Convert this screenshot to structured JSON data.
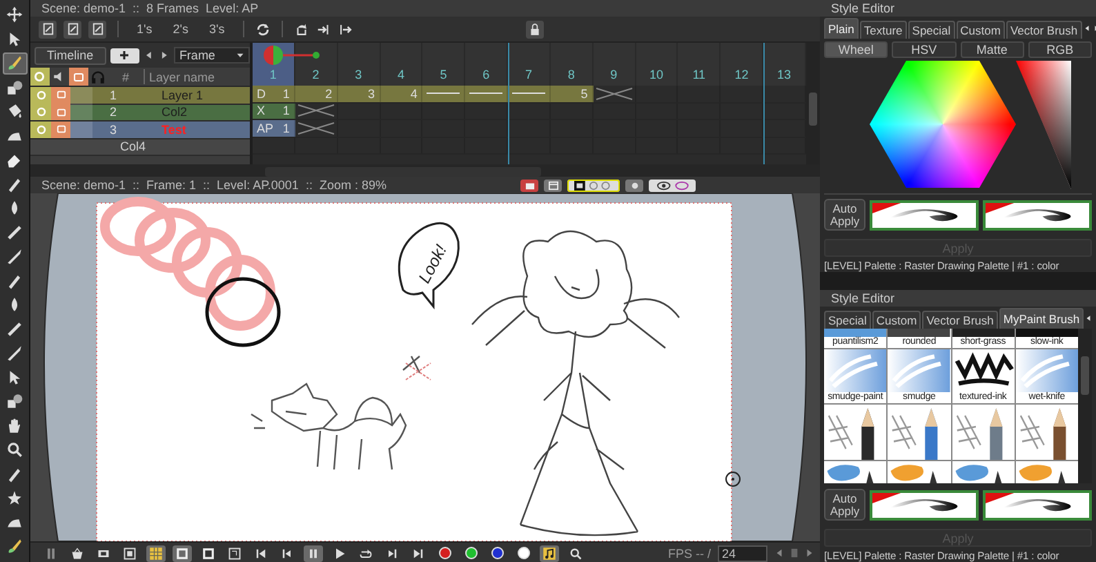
{
  "toolbox": {
    "tools": [
      {
        "kind": "animate",
        "selected": false
      },
      {
        "kind": "arrow",
        "selected": false
      },
      {
        "kind": "brush",
        "selected": true
      },
      {
        "kind": "shapes",
        "selected": false
      },
      {
        "kind": "bucket",
        "selected": false
      },
      {
        "kind": "iron",
        "selected": false
      },
      {
        "kind": "eraser",
        "selected": false
      },
      {
        "kind": "pen",
        "selected": false
      },
      {
        "kind": "drop",
        "selected": false
      },
      {
        "kind": "ruler",
        "selected": false
      },
      {
        "kind": "knife",
        "selected": false
      },
      {
        "kind": "pen",
        "selected": false
      },
      {
        "kind": "drop",
        "selected": false
      },
      {
        "kind": "ruler",
        "selected": false
      },
      {
        "kind": "knife",
        "selected": false
      },
      {
        "kind": "arrow",
        "selected": false
      },
      {
        "kind": "shapes",
        "selected": false
      },
      {
        "kind": "hand",
        "selected": false
      },
      {
        "kind": "zoom",
        "selected": false
      },
      {
        "kind": "pen",
        "selected": false
      },
      {
        "kind": "star",
        "selected": false
      },
      {
        "kind": "iron",
        "selected": false
      },
      {
        "kind": "brush",
        "selected": false
      }
    ]
  },
  "timeline": {
    "title": "Scene: demo-1  ::  8 Frames  Level: AP",
    "step_buttons": [
      {
        "label": "1's"
      },
      {
        "label": "2's"
      },
      {
        "label": "3's"
      }
    ],
    "tab": "Timeline",
    "frame_mode": "Frame",
    "number_header": "#",
    "layer_name_field": {
      "placeholder": "Layer name"
    },
    "frames": [
      {
        "label": "1",
        "selected": true
      },
      {
        "label": "2",
        "selected": false
      },
      {
        "label": "3",
        "selected": false
      },
      {
        "label": "4",
        "selected": false
      },
      {
        "label": "5",
        "selected": false
      },
      {
        "label": "6",
        "selected": false
      },
      {
        "label": "7",
        "selected": false
      },
      {
        "label": "8",
        "selected": false
      },
      {
        "label": "9",
        "selected": false
      },
      {
        "label": "10",
        "selected": false
      },
      {
        "label": "11",
        "selected": false
      },
      {
        "label": "12",
        "selected": false
      },
      {
        "label": "13",
        "selected": false
      }
    ],
    "layers": [
      {
        "number": "1",
        "name": "Layer 1",
        "color": "#77773f",
        "selected": false,
        "preview": true,
        "camstand": true,
        "cells": [
          {
            "kind": "start",
            "level_name": "D",
            "frame": "1"
          },
          {
            "kind": "value",
            "frame": "2"
          },
          {
            "kind": "value",
            "frame": "3"
          },
          {
            "kind": "value",
            "frame": "4"
          },
          {
            "kind": "hold"
          },
          {
            "kind": "hold"
          },
          {
            "kind": "hold"
          },
          {
            "kind": "value",
            "frame": "5"
          },
          {
            "kind": "end"
          }
        ]
      },
      {
        "number": "2",
        "name": "Col2",
        "color": "#4a6e43",
        "selected": false,
        "preview": true,
        "camstand": true,
        "cells": [
          {
            "kind": "start",
            "level_name": "X",
            "frame": "1"
          },
          {
            "kind": "end"
          }
        ]
      },
      {
        "number": "3",
        "name": "Test",
        "color": "#5a6d8c",
        "selected": true,
        "preview": true,
        "camstand": true,
        "cells": [
          {
            "kind": "start",
            "level_name": "AP",
            "frame": "1"
          },
          {
            "kind": "end"
          }
        ]
      },
      {
        "name": "Col4",
        "color": "#464646",
        "selected": false,
        "preview": false,
        "camstand": false
      }
    ]
  },
  "viewer": {
    "title": "Scene: demo-1  ::  Frame: 1  ::  Level: AP.0001  ::  Zoom : 89%",
    "speech_text": "Look!"
  },
  "playbar": {
    "buttons": [
      {
        "kind": "grip",
        "on": false
      },
      {
        "kind": "basket",
        "on": false
      },
      {
        "kind": "film",
        "on": false
      },
      {
        "kind": "frame",
        "on": false
      },
      {
        "kind": "grid",
        "on": true
      },
      {
        "kind": "square",
        "on": true
      },
      {
        "kind": "square",
        "on": false
      },
      {
        "kind": "fit",
        "on": false
      },
      {
        "kind": "first",
        "on": false
      },
      {
        "kind": "prev",
        "on": false
      },
      {
        "kind": "pause",
        "on": true
      },
      {
        "kind": "play",
        "on": false
      },
      {
        "kind": "loop",
        "on": false
      },
      {
        "kind": "next",
        "on": false
      },
      {
        "kind": "last",
        "on": false
      },
      {
        "kind": "channel",
        "color": "#d42020",
        "on": false
      },
      {
        "kind": "channel",
        "color": "#20c030",
        "on": false
      },
      {
        "kind": "channel",
        "color": "#2030d0",
        "on": false
      },
      {
        "kind": "channel",
        "color": "#ffffff",
        "on": false
      },
      {
        "kind": "sound",
        "on": true
      },
      {
        "kind": "zoom",
        "on": false
      }
    ],
    "fps_label": "FPS -- /",
    "fps_value": "24"
  },
  "style_editors": [
    {
      "kind": "plain",
      "title": "Style Editor",
      "tabs": [
        {
          "label": "Plain",
          "selected": true
        },
        {
          "label": "Texture",
          "selected": false
        },
        {
          "label": "Special",
          "selected": false
        },
        {
          "label": "Custom",
          "selected": false
        },
        {
          "label": "Vector Brush",
          "selected": false
        }
      ],
      "modes": [
        {
          "label": "Wheel",
          "selected": true
        },
        {
          "label": "HSV",
          "selected": false
        },
        {
          "label": "Matte",
          "selected": false
        },
        {
          "label": "RGB",
          "selected": false
        }
      ],
      "auto_apply": "Auto Apply",
      "apply": {
        "label": "Apply",
        "disabled": true
      },
      "status": "[LEVEL] Palette : Raster Drawing Palette | #1 : color"
    },
    {
      "kind": "mypaint",
      "title": "Style Editor",
      "tabs": [
        {
          "label": "Special",
          "selected": false
        },
        {
          "label": "Custom",
          "selected": false
        },
        {
          "label": "Vector Brush",
          "selected": false
        },
        {
          "label": "MyPaint Brush",
          "selected": true
        }
      ],
      "brushes": [
        {
          "kind": "sketch",
          "label": "puantilism2",
          "color": "#5a9ad8"
        },
        {
          "kind": "sketch",
          "label": "rounded",
          "color": "#444444"
        },
        {
          "kind": "sketch",
          "label": "short-grass",
          "color": "#222222"
        },
        {
          "kind": "sketch",
          "label": "slow-ink",
          "color": "#111111"
        },
        {
          "kind": "smear",
          "label": "smudge-paint",
          "color": "#6d9fdc"
        },
        {
          "kind": "smear",
          "label": "smudge",
          "color": "#6d9fdc"
        },
        {
          "kind": "ink",
          "label": "textured-ink",
          "color": "#111111"
        },
        {
          "kind": "smear",
          "label": "wet-knife",
          "color": "#6d9fdc"
        },
        {
          "kind": "pencil",
          "color": "#2a2a2a"
        },
        {
          "kind": "pencil",
          "color": "#3a78c8"
        },
        {
          "kind": "pencil",
          "color": "#6e7c8a"
        },
        {
          "kind": "pencil",
          "color": "#7a5030"
        },
        {
          "kind": "blob",
          "color": "#5a9ad8"
        },
        {
          "kind": "blob",
          "color": "#f0a030"
        },
        {
          "kind": "blob",
          "color": "#5a9ad8"
        },
        {
          "kind": "blob",
          "color": "#f0a030"
        }
      ],
      "auto_apply": "Auto Apply",
      "apply": {
        "label": "Apply",
        "disabled": true
      },
      "status": "[LEVEL] Palette : Raster Drawing Palette | #1 : color"
    }
  ]
}
